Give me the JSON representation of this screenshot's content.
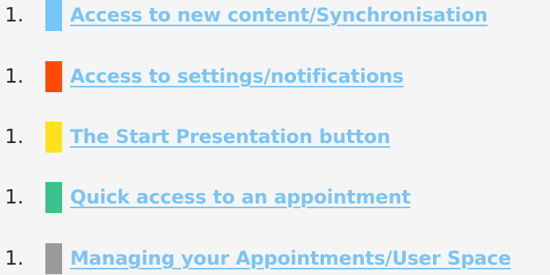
{
  "items": [
    {
      "number": "1.",
      "label": "Access to new content/Synchronisation",
      "color": "#74c8f8"
    },
    {
      "number": "1.",
      "label": "Access to settings/notifications",
      "color": "#ff4a06"
    },
    {
      "number": "1.",
      "label": "The Start Presentation button",
      "color": "#ffe21c"
    },
    {
      "number": "1.",
      "label": "Quick access to an appointment",
      "color": "#3cc28c"
    },
    {
      "number": "1.",
      "label": "Managing your Appointments/User Space",
      "color": "#9a9a9a"
    }
  ]
}
